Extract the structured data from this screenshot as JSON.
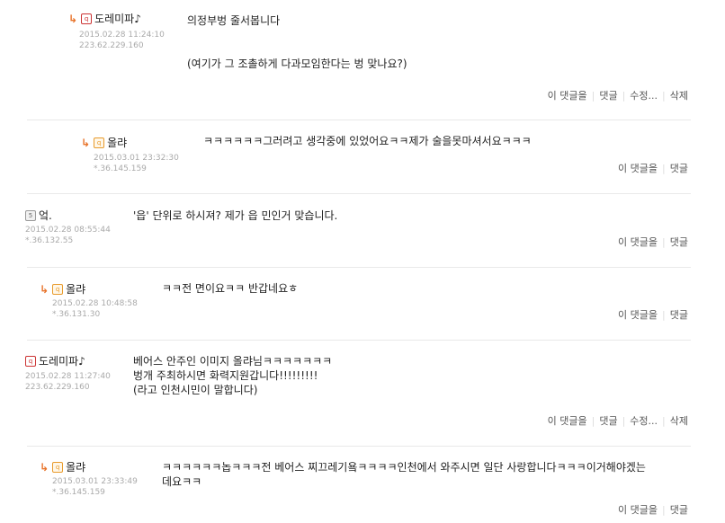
{
  "comments": [
    {
      "author": "도레미파♪",
      "date": "2015.02.28 11:24:10",
      "ip": "223.62.229.160",
      "text": "의정부벙 줄서봅니다\n\n\n(여기가 그 조촐하게 다과모임한다는 벙 맞나요?)",
      "actions": [
        "이 댓글을",
        "댓글",
        "수정...",
        "삭제"
      ]
    },
    {
      "author": "올랴",
      "date": "2015.03.01 23:32:30",
      "ip": "*.36.145.159",
      "text": "ㅋㅋㅋㅋㅋㅋ그러려고 생각중에 있었어요ㅋㅋ제가 술을못마셔서요ㅋㅋㅋ",
      "actions": [
        "이 댓글을",
        "댓글"
      ]
    },
    {
      "author": "엌.",
      "date": "2015.02.28 08:55:44",
      "ip": "*.36.132.55",
      "text": "'읍' 단위로 하시져? 제가 읍 민인거 맞습니다.",
      "actions": [
        "이 댓글을",
        "댓글"
      ]
    },
    {
      "author": "올랴",
      "date": "2015.02.28 10:48:58",
      "ip": "*.36.131.30",
      "text": "ㅋㅋ전 면이요ㅋㅋ 반갑네요ㅎ",
      "actions": [
        "이 댓글을",
        "댓글"
      ]
    },
    {
      "author": "도레미파♪",
      "date": "2015.02.28 11:27:40",
      "ip": "223.62.229.160",
      "text": "베어스 안주인 이미지 올랴님ㅋㅋㅋㅋㅋㅋㅋ\n벙개 주최하시면 화력지원갑니다!!!!!!!!!\n(라고 인천시민이 말합니다)",
      "actions": [
        "이 댓글을",
        "댓글",
        "수정...",
        "삭제"
      ]
    },
    {
      "author": "올랴",
      "date": "2015.03.01 23:33:49",
      "ip": "*.36.145.159",
      "text": "ㅋㅋㅋㅋㅋㅋ놉ㅋㅋㅋ전 베어스 찌끄레기욬ㅋㅋㅋㅋ인천에서 와주시면 일단 사랑합니다ㅋㅋㅋ이거해야겠는\n데요ㅋㅋ",
      "actions": [
        "이 댓글을",
        "댓글"
      ]
    }
  ],
  "icons": {
    "reply": "reply-arrow-icon",
    "level": "level-badge-icon"
  }
}
